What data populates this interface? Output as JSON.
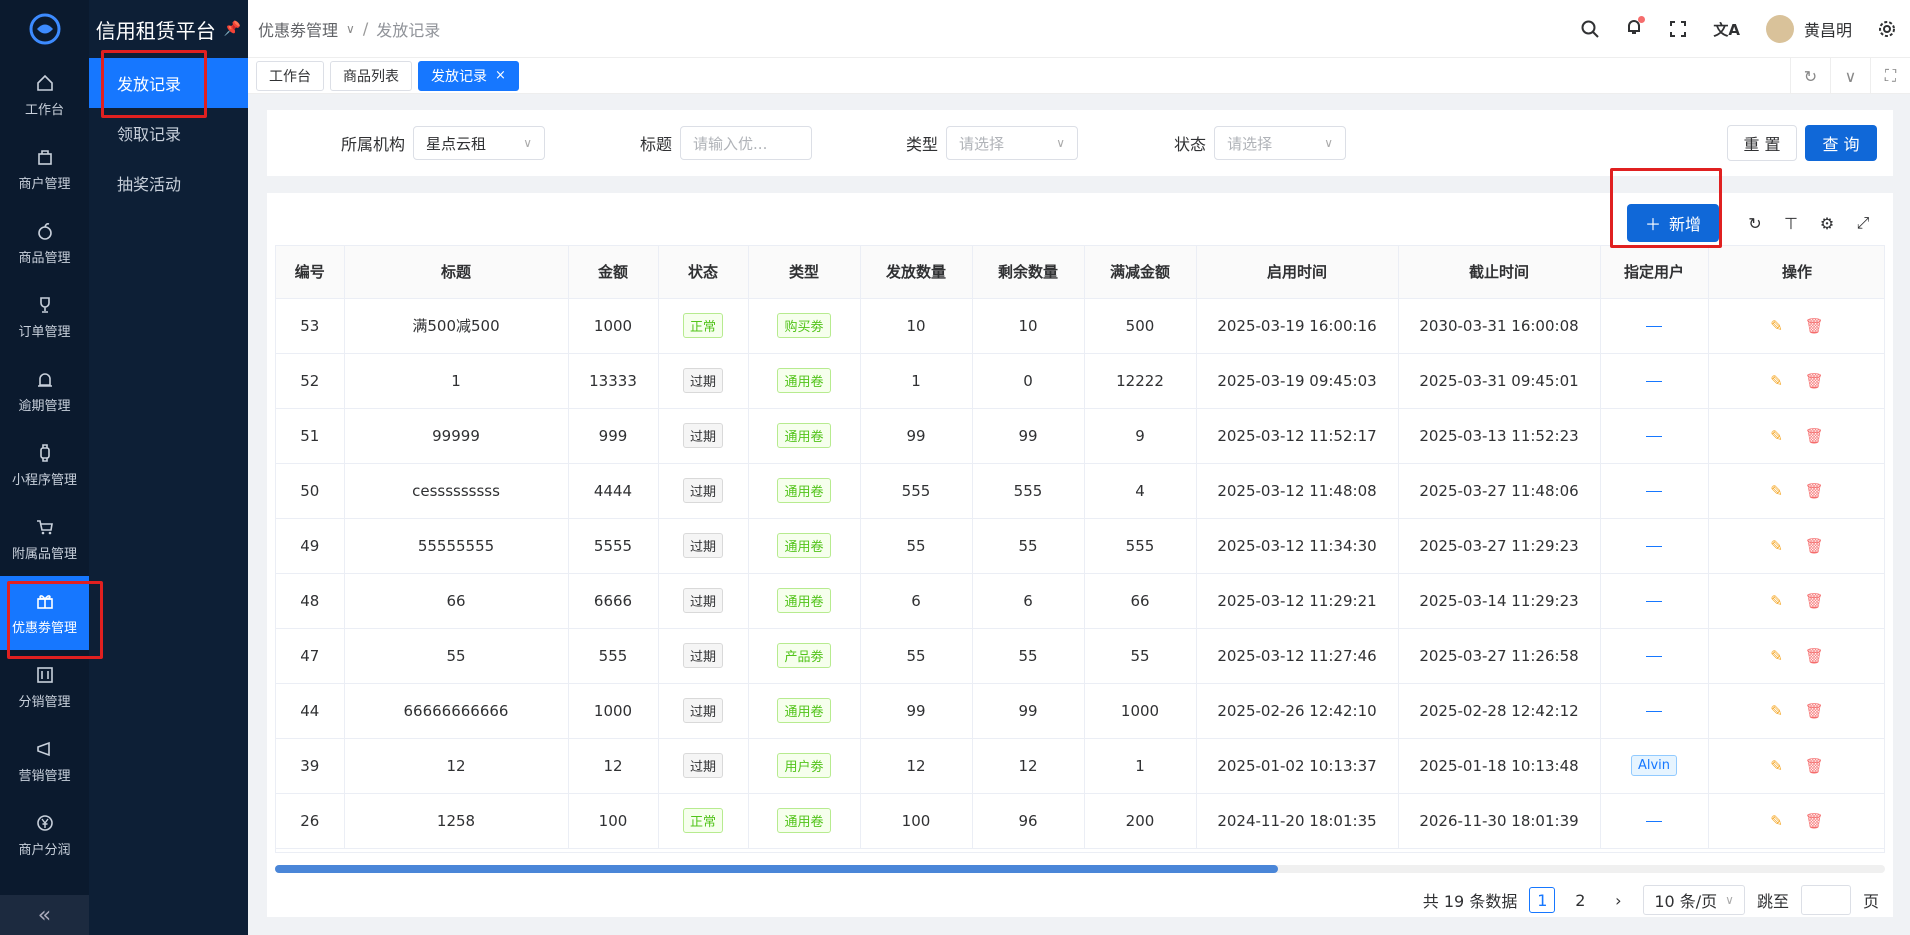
{
  "app": {
    "title": "信用租赁平台"
  },
  "rail": [
    {
      "label": "工作台",
      "icon": "home-icon"
    },
    {
      "label": "商户管理",
      "icon": "bag-icon"
    },
    {
      "label": "商品管理",
      "icon": "apple-icon"
    },
    {
      "label": "订单管理",
      "icon": "trophy-icon"
    },
    {
      "label": "逾期管理",
      "icon": "alarm-icon"
    },
    {
      "label": "小程序管理",
      "icon": "watch-icon"
    },
    {
      "label": "附属品管理",
      "icon": "cart-icon"
    },
    {
      "label": "优惠劵管理",
      "icon": "gift-icon"
    },
    {
      "label": "分销管理",
      "icon": "sliders-icon"
    },
    {
      "label": "营销管理",
      "icon": "megaphone-icon"
    },
    {
      "label": "商户分润",
      "icon": "yen-icon"
    }
  ],
  "submenu": [
    "发放记录",
    "领取记录",
    "抽奖活动"
  ],
  "breadcrumb": {
    "parent": "优惠劵管理",
    "sep": "/",
    "current": "发放记录"
  },
  "user": {
    "name": "黄昌明"
  },
  "tabs": [
    "工作台",
    "商品列表",
    "发放记录"
  ],
  "filters": {
    "org_label": "所属机构",
    "org_value": "星点云租",
    "title_label": "标题",
    "title_placeholder": "请输入优...",
    "type_label": "类型",
    "type_placeholder": "请选择",
    "status_label": "状态",
    "status_placeholder": "请选择",
    "reset": "重 置",
    "search": "查 询"
  },
  "toolbar": {
    "add": "新增"
  },
  "table": {
    "headers": [
      "编号",
      "标题",
      "金额",
      "状态",
      "类型",
      "发放数量",
      "剩余数量",
      "满减金额",
      "启用时间",
      "截止时间",
      "指定用户",
      "操作"
    ],
    "rows": [
      {
        "id": "53",
        "title": "满500减500",
        "amount": "1000",
        "status": "正常",
        "type": "购买劵",
        "issued": "10",
        "remain": "10",
        "threshold": "500",
        "start": "2025-03-19 16:00:16",
        "end": "2030-03-31 16:00:08",
        "user": ""
      },
      {
        "id": "52",
        "title": "1",
        "amount": "13333",
        "status": "过期",
        "type": "通用卷",
        "issued": "1",
        "remain": "0",
        "threshold": "12222",
        "start": "2025-03-19 09:45:03",
        "end": "2025-03-31 09:45:01",
        "user": ""
      },
      {
        "id": "51",
        "title": "99999",
        "amount": "999",
        "status": "过期",
        "type": "通用卷",
        "issued": "99",
        "remain": "99",
        "threshold": "9",
        "start": "2025-03-12 11:52:17",
        "end": "2025-03-13 11:52:23",
        "user": ""
      },
      {
        "id": "50",
        "title": "cesssssssss",
        "amount": "4444",
        "status": "过期",
        "type": "通用卷",
        "issued": "555",
        "remain": "555",
        "threshold": "4",
        "start": "2025-03-12 11:48:08",
        "end": "2025-03-27 11:48:06",
        "user": ""
      },
      {
        "id": "49",
        "title": "55555555",
        "amount": "5555",
        "status": "过期",
        "type": "通用卷",
        "issued": "55",
        "remain": "55",
        "threshold": "555",
        "start": "2025-03-12 11:34:30",
        "end": "2025-03-27 11:29:23",
        "user": ""
      },
      {
        "id": "48",
        "title": "66",
        "amount": "6666",
        "status": "过期",
        "type": "通用卷",
        "issued": "6",
        "remain": "6",
        "threshold": "66",
        "start": "2025-03-12 11:29:21",
        "end": "2025-03-14 11:29:23",
        "user": ""
      },
      {
        "id": "47",
        "title": "55",
        "amount": "555",
        "status": "过期",
        "type": "产品劵",
        "issued": "55",
        "remain": "55",
        "threshold": "55",
        "start": "2025-03-12 11:27:46",
        "end": "2025-03-27 11:26:58",
        "user": ""
      },
      {
        "id": "44",
        "title": "66666666666",
        "amount": "1000",
        "status": "过期",
        "type": "通用卷",
        "issued": "99",
        "remain": "99",
        "threshold": "1000",
        "start": "2025-02-26 12:42:10",
        "end": "2025-02-28 12:42:12",
        "user": ""
      },
      {
        "id": "39",
        "title": "12",
        "amount": "12",
        "status": "过期",
        "type": "用户劵",
        "issued": "12",
        "remain": "12",
        "threshold": "1",
        "start": "2025-01-02 10:13:37",
        "end": "2025-01-18 10:13:48",
        "user": "Alvin"
      },
      {
        "id": "26",
        "title": "1258",
        "amount": "100",
        "status": "正常",
        "type": "通用卷",
        "issued": "100",
        "remain": "96",
        "threshold": "200",
        "start": "2024-11-20 18:01:35",
        "end": "2026-11-30 18:01:39",
        "user": ""
      }
    ]
  },
  "pagination": {
    "total": "共 19 条数据",
    "pages": [
      "1",
      "2"
    ],
    "page_size": "10 条/页",
    "jump_label": "跳至",
    "page_unit": "页"
  }
}
